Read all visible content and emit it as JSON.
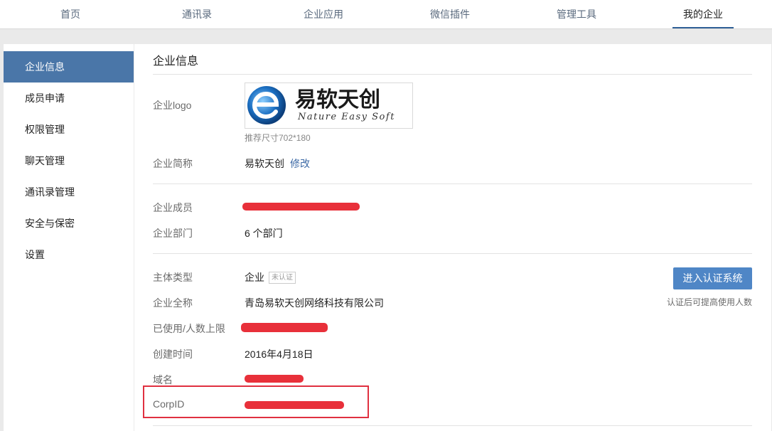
{
  "nav": {
    "tabs": [
      {
        "label": "首页"
      },
      {
        "label": "通讯录"
      },
      {
        "label": "企业应用"
      },
      {
        "label": "微信插件"
      },
      {
        "label": "管理工具"
      },
      {
        "label": "我的企业",
        "active": true
      }
    ],
    "active_color": "#2f5f97"
  },
  "sidebar": {
    "items": [
      {
        "label": "企业信息",
        "active": true
      },
      {
        "label": "成员申请"
      },
      {
        "label": "权限管理"
      },
      {
        "label": "聊天管理"
      },
      {
        "label": "通讯录管理"
      },
      {
        "label": "安全与保密"
      },
      {
        "label": "设置"
      }
    ],
    "active_color": "#4a76a8"
  },
  "main": {
    "title": "企业信息",
    "logo": {
      "label": "企业logo",
      "brand_text": "易软天创",
      "brand_sub": "Nature Easy Soft",
      "hint": "推荐尺寸702*180"
    },
    "short_name": {
      "label": "企业简称",
      "value": "易软天创",
      "edit_label": "修改"
    },
    "members": {
      "label": "企业成员",
      "value": "",
      "redacted": true
    },
    "departments": {
      "label": "企业部门",
      "value": "6 个部门"
    },
    "entity_type": {
      "label": "主体类型",
      "value": "企业",
      "badge": "未认证"
    },
    "verify_button": "进入认证系统",
    "verify_hint": "认证后可提高使用人数",
    "full_name": {
      "label": "企业全称",
      "value": "青岛易软天创网络科技有限公司"
    },
    "usage": {
      "label": "已使用/人数上限",
      "value": "",
      "redacted": true
    },
    "created": {
      "label": "创建时间",
      "value": "2016年4月18日"
    },
    "domain": {
      "label": "域名",
      "value": "",
      "redacted": true
    },
    "corpid": {
      "label": "CorpID",
      "value": "",
      "redacted": true
    }
  },
  "colors": {
    "redaction": "#e8303a",
    "highlight_box": "#e03040",
    "button_bg": "#4f86c6",
    "link": "#3d6aa6"
  }
}
